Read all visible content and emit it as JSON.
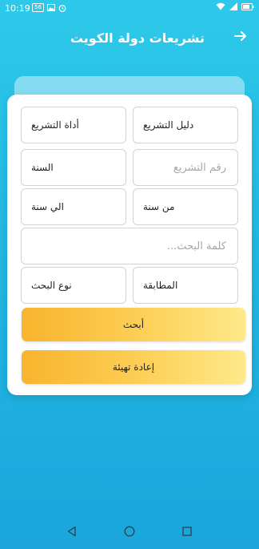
{
  "status_bar": {
    "time": "10:19",
    "badge": "56",
    "icons": [
      "image-icon",
      "alarm-icon",
      "wifi-icon",
      "signal-icon",
      "battery-icon"
    ]
  },
  "header": {
    "title": "تشريعات دولة الكويت",
    "back_icon": "arrow-right-icon"
  },
  "form": {
    "legislation_guide": "دليل التشريع",
    "legislation_tool": "أداة التشريع",
    "legislation_number_placeholder": "رقم التشريع",
    "year": "السنة",
    "from_year": "من سنة",
    "to_year": "الي سنة",
    "search_word_placeholder": "كلمة البحث...",
    "match": "المطابقة",
    "search_type": "نوع البحث"
  },
  "buttons": {
    "search": "أبحث",
    "reset": "إعادة تهيئة"
  },
  "colors": {
    "background_top": "#2ec9ea",
    "background_bottom": "#1aa6dc",
    "button_left": "#f8b42d",
    "button_right": "#fee98a"
  },
  "nav_bar": {
    "icons": [
      "back-triangle-icon",
      "home-circle-icon",
      "recents-square-icon"
    ]
  }
}
